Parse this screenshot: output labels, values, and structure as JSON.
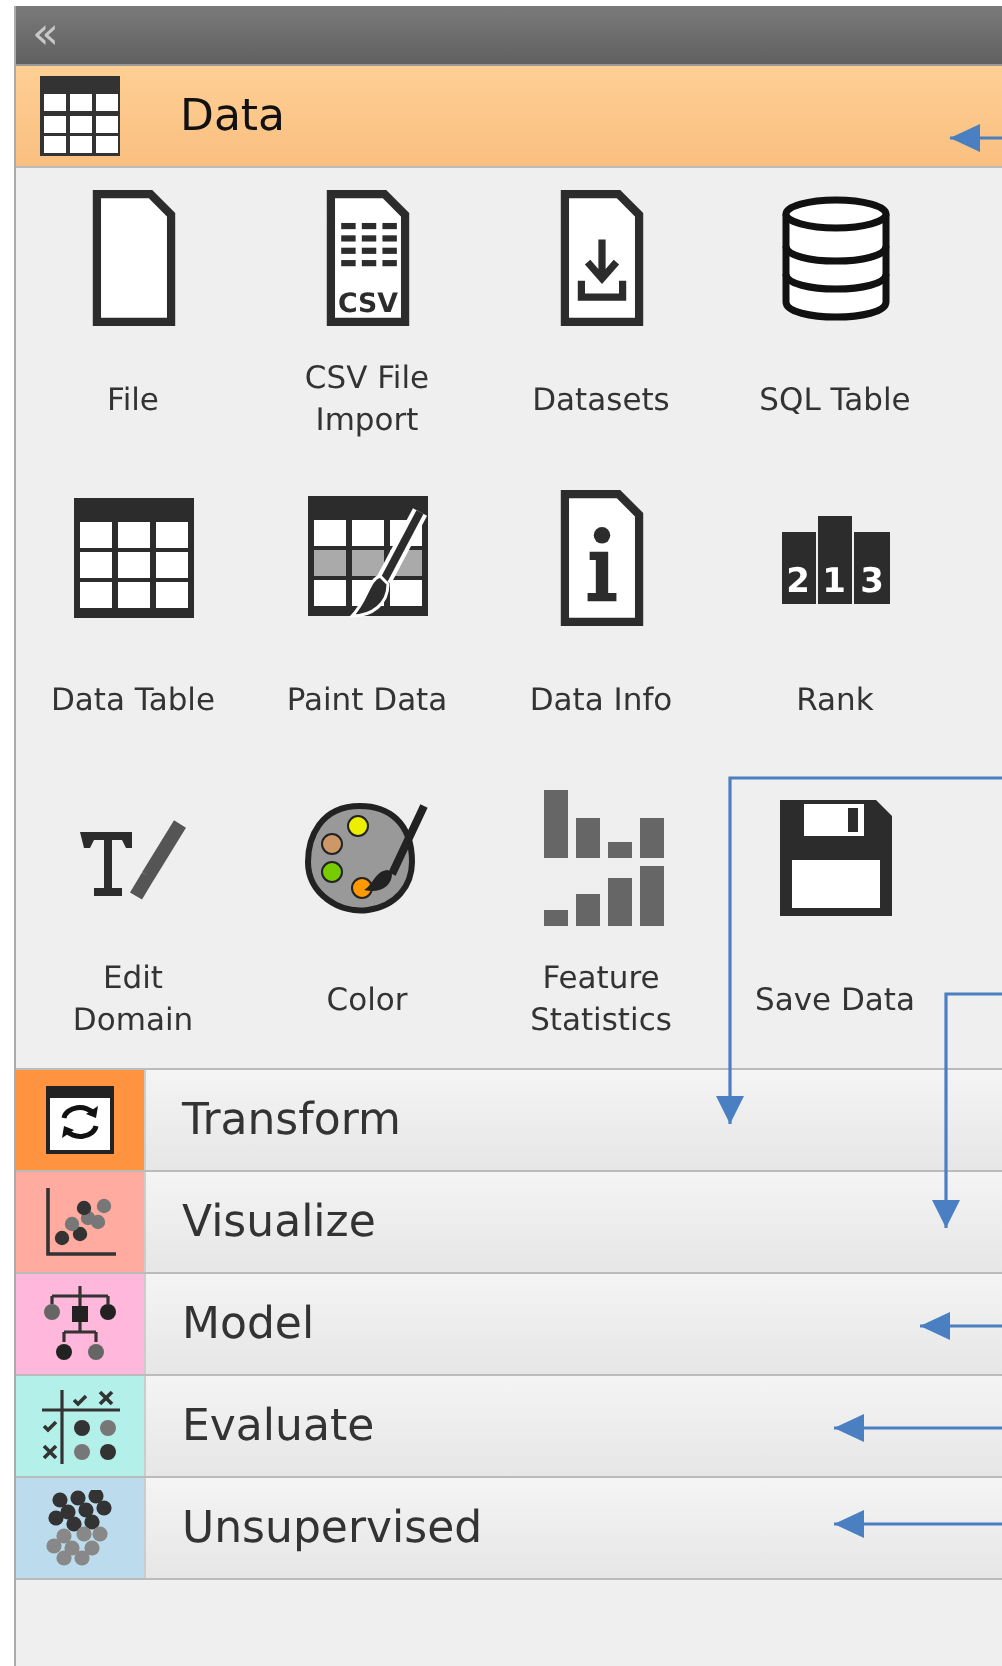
{
  "toolbar": {
    "collapse_glyph": "«"
  },
  "categories": [
    {
      "name": "Data",
      "color": "#ffcf94",
      "expanded": true,
      "widgets": [
        {
          "label": "File"
        },
        {
          "label": "CSV File\nImport",
          "icon_text": [
            "CSV"
          ]
        },
        {
          "label": "Datasets"
        },
        {
          "label": "SQL Table"
        },
        {
          "label": "Data Table"
        },
        {
          "label": "Paint Data"
        },
        {
          "label": "Data Info"
        },
        {
          "label": "Rank",
          "icon_text": [
            "2",
            "1",
            "3"
          ]
        },
        {
          "label": "Edit\nDomain"
        },
        {
          "label": "Color"
        },
        {
          "label": "Feature\nStatistics"
        },
        {
          "label": "Save Data"
        }
      ]
    },
    {
      "name": "Transform",
      "color": "#ff9340",
      "expanded": false
    },
    {
      "name": "Visualize",
      "color": "#ffab9f",
      "expanded": false
    },
    {
      "name": "Model",
      "color": "#ffb8db",
      "expanded": false
    },
    {
      "name": "Evaluate",
      "color": "#b4f0ea",
      "expanded": false
    },
    {
      "name": "Unsupervised",
      "color": "#bcdcee",
      "expanded": false
    }
  ]
}
